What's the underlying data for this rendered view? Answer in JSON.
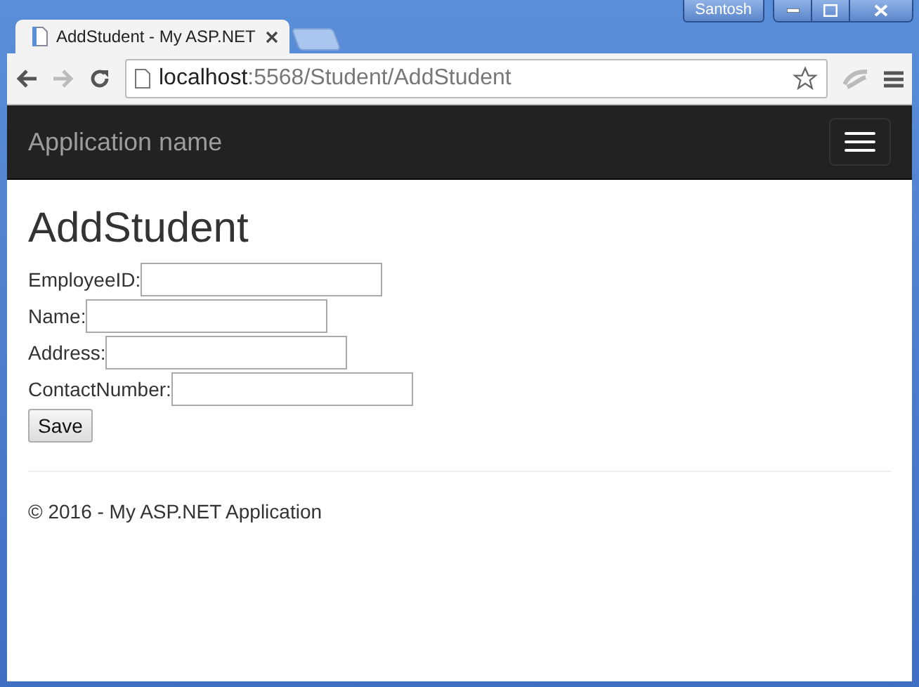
{
  "browser": {
    "user": "Santosh",
    "tabs": [
      {
        "title": "AddStudent - My ASP.NET",
        "selected": true
      }
    ],
    "url": {
      "host": "localhost",
      "path": ":5568/Student/AddStudent"
    }
  },
  "navbar": {
    "brand": "Application name"
  },
  "page": {
    "heading": "AddStudent",
    "fields": [
      {
        "label": "EmployeeID:"
      },
      {
        "label": "Name:"
      },
      {
        "label": "Address:"
      },
      {
        "label": "ContactNumber:"
      }
    ],
    "button": "Save"
  },
  "footer": "© 2016 - My ASP.NET Application"
}
